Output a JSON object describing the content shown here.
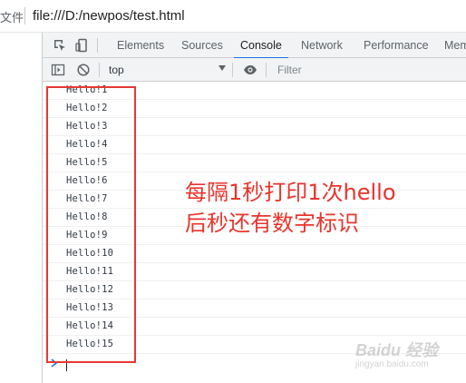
{
  "browser": {
    "address_prefix": "文件",
    "url": "file:///D:/newpos/test.html"
  },
  "devtools": {
    "tabs": [
      {
        "label": "Elements",
        "active": false
      },
      {
        "label": "Sources",
        "active": false
      },
      {
        "label": "Console",
        "active": true
      },
      {
        "label": "Network",
        "active": false
      },
      {
        "label": "Performance",
        "active": false
      },
      {
        "label": "Mem",
        "active": false
      }
    ],
    "toolbar": {
      "context": "top",
      "filter_placeholder": "Filter"
    },
    "icons": [
      "inspect-element-icon",
      "device-toolbar-icon",
      "sidebar-toggle-icon",
      "clear-console-icon",
      "eye-icon"
    ],
    "active_tab_color": "#1a73e8"
  },
  "console": {
    "logs": [
      "Hello!1",
      "Hello!2",
      "Hello!3",
      "Hello!4",
      "Hello!5",
      "Hello!6",
      "Hello!7",
      "Hello!8",
      "Hello!9",
      "Hello!10",
      "Hello!11",
      "Hello!12",
      "Hello!13",
      "Hello!14",
      "Hello!15"
    ],
    "prompt_icon": "chevron-right-icon"
  },
  "annotation": {
    "line1": "每隔1秒打印1次hello",
    "line2": "后秒还有数字标识",
    "color": "#e8342c",
    "box_color": "#e53935"
  },
  "watermark": {
    "logo": "Baidu 经验",
    "url": "jingyan.baidu.com"
  }
}
